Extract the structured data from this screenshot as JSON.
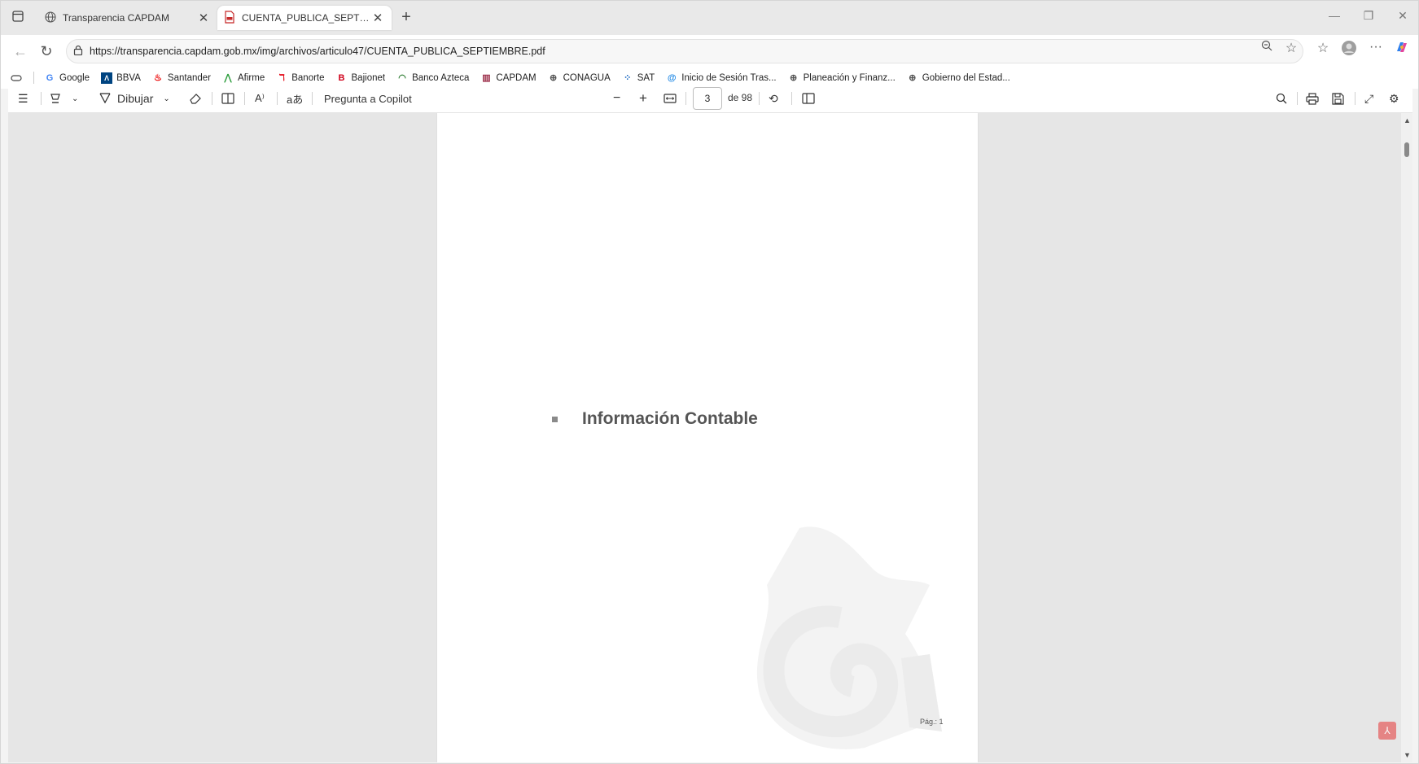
{
  "tabs": {
    "inactive_title": "Transparencia CAPDAM",
    "active_title": "CUENTA_PUBLICA_SEPTIEMBRE.pdf",
    "new_tab_label": "+",
    "close_label": "✕"
  },
  "address_bar": {
    "url": "https://transparencia.capdam.gob.mx/img/archivos/articulo47/CUENTA_PUBLICA_SEPTIEMBRE.pdf"
  },
  "bookmarks": [
    {
      "label": "Google",
      "icon": "google-icon",
      "color": "#4285f4"
    },
    {
      "label": "BBVA",
      "icon": "bbva-icon",
      "color": "#004481"
    },
    {
      "label": "Santander",
      "icon": "santander-icon",
      "color": "#ec0000"
    },
    {
      "label": "Afirme",
      "icon": "afirme-icon",
      "color": "#2e9e3e"
    },
    {
      "label": "Banorte",
      "icon": "banorte-icon",
      "color": "#e30613"
    },
    {
      "label": "Bajionet",
      "icon": "bajionet-icon",
      "color": "#d0021b"
    },
    {
      "label": "Banco Azteca",
      "icon": "azteca-icon",
      "color": "#2e7d32"
    },
    {
      "label": "CAPDAM",
      "icon": "capdam-icon",
      "color": "#9c2f4a"
    },
    {
      "label": "CONAGUA",
      "icon": "globe-icon",
      "color": "#555555"
    },
    {
      "label": "SAT",
      "icon": "sat-icon",
      "color": "#1565c0"
    },
    {
      "label": "Inicio de Sesión Tras...",
      "icon": "login-icon",
      "color": "#1e88e5"
    },
    {
      "label": "Planeación y Finanz...",
      "icon": "globe-icon",
      "color": "#555555"
    },
    {
      "label": "Gobierno del Estad...",
      "icon": "globe-icon",
      "color": "#555555"
    }
  ],
  "pdf_toolbar": {
    "draw_label": "Dibujar",
    "copilot_label": "Pregunta a Copilot",
    "current_page": "3",
    "page_count_label": "de 98"
  },
  "pdf_page": {
    "heading": "Información Contable",
    "page_number": "Pág.: 1"
  }
}
